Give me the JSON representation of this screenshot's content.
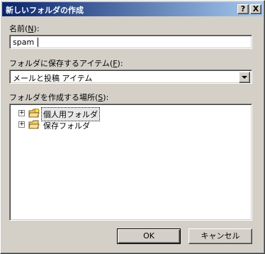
{
  "window": {
    "title": "新しいフォルダの作成",
    "help_glyph": "?",
    "close_glyph": "X"
  },
  "name_section": {
    "label": "名前(",
    "accelerator": "N",
    "label_end": "):",
    "value": "spam"
  },
  "type_section": {
    "label": "フォルダに保存するアイテム(",
    "accelerator": "F",
    "label_end": "):",
    "selected": "メールと投稿 アイテム"
  },
  "location_section": {
    "label": "フォルダを作成する場所(",
    "accelerator": "S",
    "label_end": "):",
    "tree": [
      {
        "label": "個人用フォルダ",
        "expander": "+",
        "icon": "personal-folders-icon",
        "selected": true
      },
      {
        "label": "保存フォルダ",
        "expander": "+",
        "icon": "archive-folders-icon",
        "selected": false
      }
    ]
  },
  "buttons": {
    "ok": "OK",
    "cancel": "キャンセル"
  }
}
